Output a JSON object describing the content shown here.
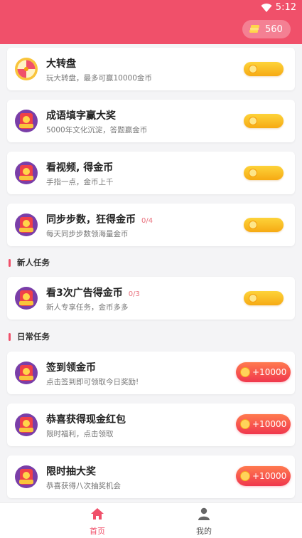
{
  "status_bar": {
    "time": "5:12"
  },
  "header": {
    "coins": "560"
  },
  "tasks": [
    {
      "title": "大转盘",
      "desc": "玩大转盘，最多可赢10000金币",
      "icon": "wheel-icon"
    },
    {
      "title": "成语填字赢大奖",
      "desc": "5000年文化沉淀，答题赢金币",
      "icon": "red-envelope-icon"
    },
    {
      "title": "看视频, 得金币",
      "desc": "手指一点，金币上千",
      "icon": "red-envelope-icon"
    },
    {
      "title": "同步步数，狂得金币",
      "progress": "0/4",
      "desc": "每天同步步数领海量金币",
      "icon": "red-envelope-icon"
    }
  ],
  "new_user_section": {
    "label": "新人任务",
    "tasks": [
      {
        "title": "看3次广告得金币",
        "progress": "0/3",
        "desc": "新人专享任务，金币多多",
        "icon": "red-envelope-icon"
      }
    ]
  },
  "daily_section": {
    "label": "日常任务",
    "tasks": [
      {
        "title": "签到领金币",
        "desc": "点击签到即可领取今日奖励!",
        "reward": "+10000",
        "icon": "red-envelope-icon"
      },
      {
        "title": "恭喜获得现金红包",
        "desc": "限时福利，点击领取",
        "reward": "+10000",
        "icon": "red-envelope-icon"
      },
      {
        "title": "限时抽大奖",
        "desc": "恭喜获得八次抽奖机会",
        "reward": "+10000",
        "icon": "red-envelope-icon"
      }
    ]
  },
  "tab_bar": {
    "home": "首页",
    "mine": "我的",
    "active_color": "#f0506a"
  },
  "colors": {
    "brand": "#f0506a",
    "coin_button": "#f6aa13"
  }
}
